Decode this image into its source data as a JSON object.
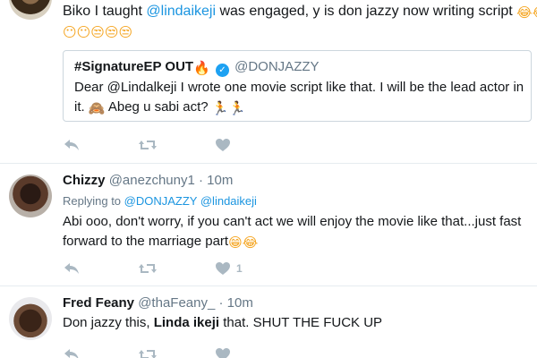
{
  "tweet1": {
    "text_before": "Biko I taught ",
    "mention": "@lindaikeji",
    "text_after": " was engaged, y is don jazzy now writing script ",
    "emoji_line1": "😂😂",
    "emoji_line2": "😶😶😒😒😒",
    "quote": {
      "name": "#SignatureEP OUT",
      "name_emoji": "🔥",
      "handle": "@DONJAZZY",
      "line1": "Dear @Lindalkeji I wrote one movie script like that. I will be the lead actor in",
      "line2_before": "it. ",
      "line2_emoji1": "🙈",
      "line2_mid": " Abeg u sabi act? ",
      "line2_emoji2": "🏃🏃"
    }
  },
  "tweet2": {
    "name": "Chizzy",
    "handle": "@anezchuny1",
    "time": "· 10m",
    "replying_prefix": "Replying to ",
    "replying_to1": "@DONJAZZY",
    "replying_to2": "@lindaikeji",
    "line1": "Abi ooo, don't worry, if you can't act we will enjoy the movie like that...just fast",
    "line2": "forward to the marriage part",
    "line2_emoji": "😁😂",
    "like_count": "1"
  },
  "tweet3": {
    "name": "Fred Feany",
    "handle": "@thaFeany_",
    "time": "· 10m",
    "text_before": "Don jazzy this, ",
    "text_bold": "Linda ikeji",
    "text_after": " that. SHUT THE FUCK UP"
  },
  "icons": {
    "reply": "reply-icon",
    "retweet": "retweet-icon",
    "like": "heart-icon",
    "verified": "verified-badge-icon"
  },
  "colors": {
    "link": "#1b95e0",
    "muted": "#657786",
    "icon": "#aab8c2",
    "verified": "#1da1f2"
  }
}
